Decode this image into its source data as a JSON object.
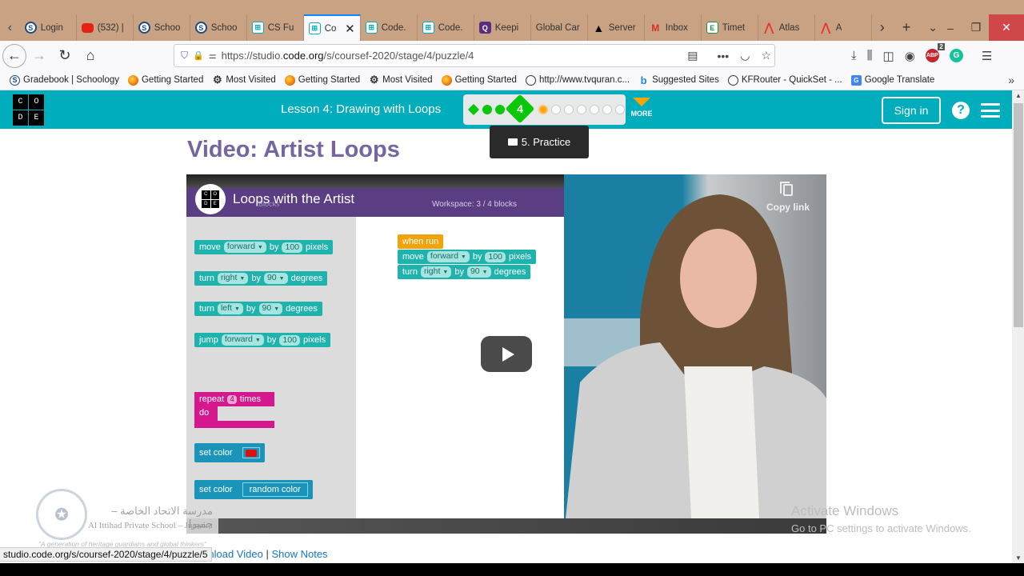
{
  "browser": {
    "tabs": [
      {
        "icon": "schoology-icon",
        "glyph": "S",
        "label": "Login",
        "cls": "sch"
      },
      {
        "icon": "youtube-icon",
        "glyph": "",
        "label": "(532) |",
        "cls": "yt"
      },
      {
        "icon": "schoology-icon",
        "glyph": "S",
        "label": "Schoo",
        "cls": "sch"
      },
      {
        "icon": "schoology-icon",
        "glyph": "S",
        "label": "Schoo",
        "cls": "sch"
      },
      {
        "icon": "code-org-icon",
        "glyph": "⊞",
        "label": "CS Fu",
        "cls": "code"
      },
      {
        "icon": "code-org-icon",
        "glyph": "⊞",
        "label": "Co",
        "cls": "code",
        "active": true
      },
      {
        "icon": "code-org-icon",
        "glyph": "⊞",
        "label": "Code.",
        "cls": "code"
      },
      {
        "icon": "code-org-icon",
        "glyph": "⊞",
        "label": "Code.",
        "cls": "code"
      },
      {
        "icon": "keeping-icon",
        "glyph": "Q",
        "label": "Keepi",
        "cls": "q"
      },
      {
        "icon": "",
        "glyph": "",
        "label": "Global Car",
        "cls": ""
      },
      {
        "icon": "warning-icon",
        "glyph": "▲",
        "label": "Server",
        "cls": "warn"
      },
      {
        "icon": "gmail-icon",
        "glyph": "M",
        "label": "Inbox",
        "cls": "gm"
      },
      {
        "icon": "timetable-icon",
        "glyph": "E",
        "label": "Timet",
        "cls": "e"
      },
      {
        "icon": "atlas-icon",
        "glyph": "⋀",
        "label": "Atlas",
        "cls": "atl"
      },
      {
        "icon": "atlas-icon",
        "glyph": "⋀",
        "label": "A",
        "cls": "atl"
      }
    ],
    "tab_close": "✕",
    "new_tab": "+",
    "tab_list": "⌄",
    "tabs_scroll_left": "‹",
    "tabs_scroll_right": "›",
    "window": {
      "minimize": "–",
      "restore": "❐",
      "close": "✕"
    },
    "url": {
      "prefix": "https://studio.",
      "domain": "code.org",
      "path": "/s/coursef-2020/stage/4/puzzle/4"
    },
    "bookmarks": [
      {
        "icon": "schoology-icon",
        "cls": "sch",
        "glyph": "S",
        "label": "Gradebook | Schoology"
      },
      {
        "icon": "firefox-icon",
        "cls": "ff",
        "glyph": "",
        "label": "Getting Started"
      },
      {
        "icon": "gear-icon",
        "cls": "gear",
        "glyph": "⚙",
        "label": "Most Visited"
      },
      {
        "icon": "firefox-icon",
        "cls": "ff",
        "glyph": "",
        "label": "Getting Started"
      },
      {
        "icon": "gear-icon",
        "cls": "gear",
        "glyph": "⚙",
        "label": "Most Visited"
      },
      {
        "icon": "firefox-icon",
        "cls": "ff",
        "glyph": "",
        "label": "Getting Started"
      },
      {
        "icon": "globe-icon",
        "cls": "globe",
        "glyph": "",
        "label": "http://www.tvquran.c..."
      },
      {
        "icon": "bing-icon",
        "cls": "bing",
        "glyph": "b",
        "label": "Suggested Sites"
      },
      {
        "icon": "globe-icon",
        "cls": "globe",
        "glyph": "",
        "label": "KFRouter - QuickSet - ..."
      },
      {
        "icon": "google-translate-icon",
        "cls": "gt",
        "glyph": "G",
        "label": "Google Translate"
      }
    ],
    "abp_badge": "2",
    "abp_label": "ABP",
    "grammarly_label": "G"
  },
  "site": {
    "logo_letters": [
      "C",
      "O",
      "D",
      "E"
    ],
    "lesson_title": "Lesson 4: Drawing with Loops",
    "current_level": "4",
    "progress": {
      "completed_before": 3,
      "current": 4,
      "hovered": 5,
      "total": 11
    },
    "more_label": "MORE",
    "signin_label": "Sign in",
    "help_label": "?",
    "tooltip": "5. Practice",
    "page_title": "Video: Artist Loops"
  },
  "video": {
    "title": "Loops with the Artist",
    "blocks_label": "Blocks",
    "workspace_label": "Workspace: 3 / 4 blocks",
    "copy_link": "Copy link",
    "toolbox": [
      {
        "parts": [
          "move",
          {
            "f": "forward",
            "dd": true
          },
          "by",
          {
            "f": "100"
          },
          "pixels"
        ]
      },
      {
        "parts": [
          "turn",
          {
            "f": "right",
            "dd": true
          },
          "by",
          {
            "f": "90",
            "dd": true
          },
          "degrees"
        ]
      },
      {
        "parts": [
          "turn",
          {
            "f": "left",
            "dd": true
          },
          "by",
          {
            "f": "90",
            "dd": true
          },
          "degrees"
        ]
      },
      {
        "parts": [
          "jump",
          {
            "f": "forward",
            "dd": true
          },
          "by",
          {
            "f": "100"
          },
          "pixels"
        ]
      }
    ],
    "repeat_block": {
      "label": "repeat",
      "count": "4",
      "times": "times",
      "do": "do"
    },
    "set_color_label": "set color",
    "set_color_value": "#e01010",
    "random_color_label": "random color",
    "workspace": {
      "when_run": "when run",
      "blocks": [
        {
          "parts": [
            "move",
            {
              "f": "forward",
              "dd": true
            },
            "by",
            {
              "f": "100"
            },
            "pixels"
          ]
        },
        {
          "parts": [
            "turn",
            {
              "f": "right",
              "dd": true
            },
            "by",
            {
              "f": "90",
              "dd": true
            },
            "degrees"
          ]
        }
      ]
    }
  },
  "school": {
    "arabic": "مدرسة الاتحاد الخاصة – جميرا",
    "english": "Al Ittihad Private School – Jumeira",
    "motto": "\"A generation of heritage guardians and global thinkers\""
  },
  "links": {
    "download": "wnload Video",
    "separator": "|",
    "notes": "Show Notes"
  },
  "status_url": "studio.code.org/s/coursef-2020/stage/4/puzzle/5",
  "watermark": {
    "title": "Activate Windows",
    "subtitle": "Go to PC settings to activate Windows."
  },
  "colors": {
    "brand_teal": "#00adbc",
    "title_purple": "#7665a0",
    "progress_green": "#0ac70a",
    "progress_orange": "#ffa400"
  }
}
